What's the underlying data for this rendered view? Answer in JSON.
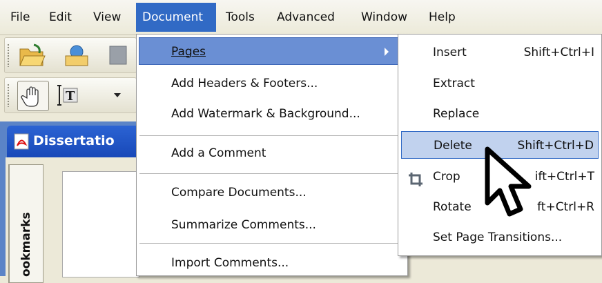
{
  "menubar": {
    "items": [
      "File",
      "Edit",
      "View",
      "Document",
      "Tools",
      "Advanced",
      "Window",
      "Help"
    ]
  },
  "document_window": {
    "tab_title": "Dissertatio",
    "bookmarks_label": "ookmarks"
  },
  "document_menu": {
    "items": [
      {
        "label": "Pages",
        "has_submenu": true
      },
      {
        "label": "Add Headers & Footers..."
      },
      {
        "label": "Add Watermark & Background..."
      },
      {
        "label": "Add a Comment"
      },
      {
        "label": "Compare Documents..."
      },
      {
        "label": "Summarize Comments..."
      },
      {
        "label": "Import Comments..."
      }
    ]
  },
  "pages_submenu": {
    "items": [
      {
        "label": "Insert",
        "shortcut": "Shift+Ctrl+I"
      },
      {
        "label": "Extract",
        "shortcut": ""
      },
      {
        "label": "Replace",
        "shortcut": ""
      },
      {
        "label": "Delete",
        "shortcut": "Shift+Ctrl+D"
      },
      {
        "label": "Crop",
        "shortcut": "ift+Ctrl+T"
      },
      {
        "label": "Rotate",
        "shortcut": "ft+Ctrl+R"
      },
      {
        "label": "Set Page Transitions...",
        "shortcut": ""
      }
    ]
  },
  "colors": {
    "menu_highlight": "#316ac5",
    "item_highlight_bg": "#c1d2ee",
    "window_title": "#1f55c9"
  }
}
